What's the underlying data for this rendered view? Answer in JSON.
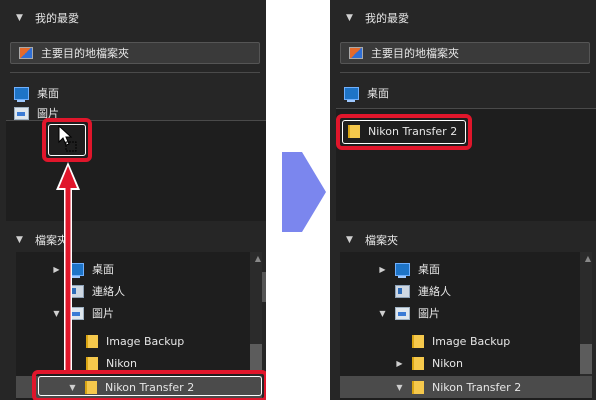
{
  "left": {
    "favorites_header": "我的最愛",
    "primary_destination": "主要目的地檔案夾",
    "favorites": [
      "桌面",
      "圖片"
    ],
    "folders_header": "檔案夾",
    "tree": [
      {
        "label": "桌面",
        "expanded": false,
        "icon": "desktop-icon"
      },
      {
        "label": "連絡人",
        "expanded": null,
        "icon": "contacts-icon"
      },
      {
        "label": "圖片",
        "expanded": true,
        "icon": "pictures-icon"
      },
      {
        "label": "Image Backup",
        "icon": "folder-icon"
      },
      {
        "label": "Nikon",
        "icon": "folder-icon"
      },
      {
        "label": "Nikon Transfer 2",
        "expanded": true,
        "icon": "folder-icon",
        "selected": true
      }
    ]
  },
  "right": {
    "favorites_header": "我的最愛",
    "primary_destination": "主要目的地檔案夾",
    "favorites": [
      "桌面",
      "Nikon Transfer 2"
    ],
    "folders_header": "檔案夾",
    "tree": [
      {
        "label": "桌面",
        "expanded": false,
        "icon": "desktop-icon"
      },
      {
        "label": "連絡人",
        "expanded": null,
        "icon": "contacts-icon"
      },
      {
        "label": "圖片",
        "expanded": true,
        "icon": "pictures-icon"
      },
      {
        "label": "Image Backup",
        "icon": "folder-icon"
      },
      {
        "label": "Nikon",
        "expanded": false,
        "icon": "folder-icon"
      },
      {
        "label": "Nikon Transfer 2",
        "expanded": true,
        "icon": "folder-icon",
        "selected": true
      }
    ]
  },
  "colors": {
    "highlight": "#e0162b",
    "arrow": "#7b86ee",
    "panel": "#262626"
  }
}
